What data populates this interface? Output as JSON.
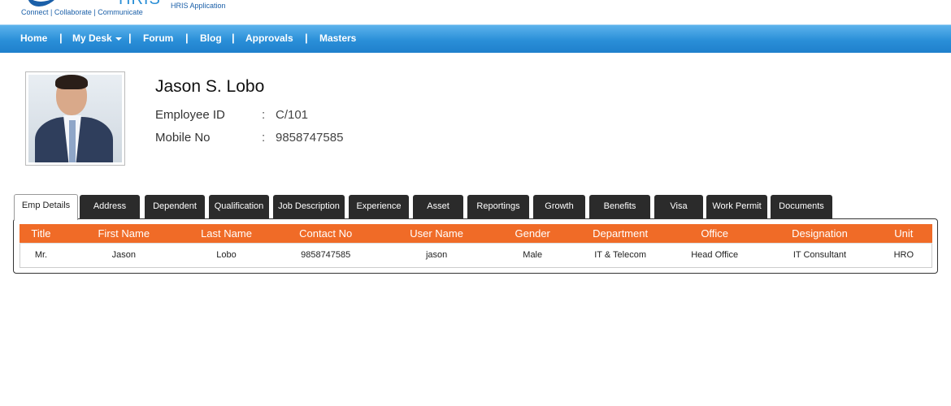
{
  "header": {
    "logo_word": "HRIS",
    "tagline": "Connect | Collaborate | Communicate",
    "app_name": "HRIS Application"
  },
  "nav": {
    "items": [
      {
        "label": "Home"
      },
      {
        "label": "My Desk"
      },
      {
        "label": "Forum"
      },
      {
        "label": "Blog"
      },
      {
        "label": "Approvals"
      },
      {
        "label": "Masters"
      }
    ],
    "separator": "|"
  },
  "profile": {
    "name": "Jason S. Lobo",
    "employee_id_label": "Employee ID",
    "employee_id": "C/101",
    "mobile_label": "Mobile No",
    "mobile": "9858747585",
    "colon": ":"
  },
  "tabs": [
    {
      "label": "Emp Details",
      "active": true
    },
    {
      "label": "Address"
    },
    {
      "label": "Dependent"
    },
    {
      "label": "Qualification"
    },
    {
      "label": "Job Description"
    },
    {
      "label": "Experience"
    },
    {
      "label": "Asset"
    },
    {
      "label": "Reportings"
    },
    {
      "label": "Growth"
    },
    {
      "label": "Benefits"
    },
    {
      "label": "Visa"
    },
    {
      "label": "Work Permit"
    },
    {
      "label": "Documents"
    }
  ],
  "table": {
    "headers": [
      "Title",
      "First Name",
      "Last Name",
      "Contact No",
      "User Name",
      "Gender",
      "Department",
      "Office",
      "Designation",
      "Unit"
    ],
    "rows": [
      [
        "Mr.",
        "Jason",
        "Lobo",
        "9858747585",
        "jason",
        "Male",
        "IT & Telecom",
        "Head Office",
        "IT Consultant",
        "HRO"
      ]
    ]
  },
  "colors": {
    "nav_blue": "#2a8fd8",
    "table_header_orange": "#f06b27",
    "tab_dark": "#2b2b2b"
  }
}
